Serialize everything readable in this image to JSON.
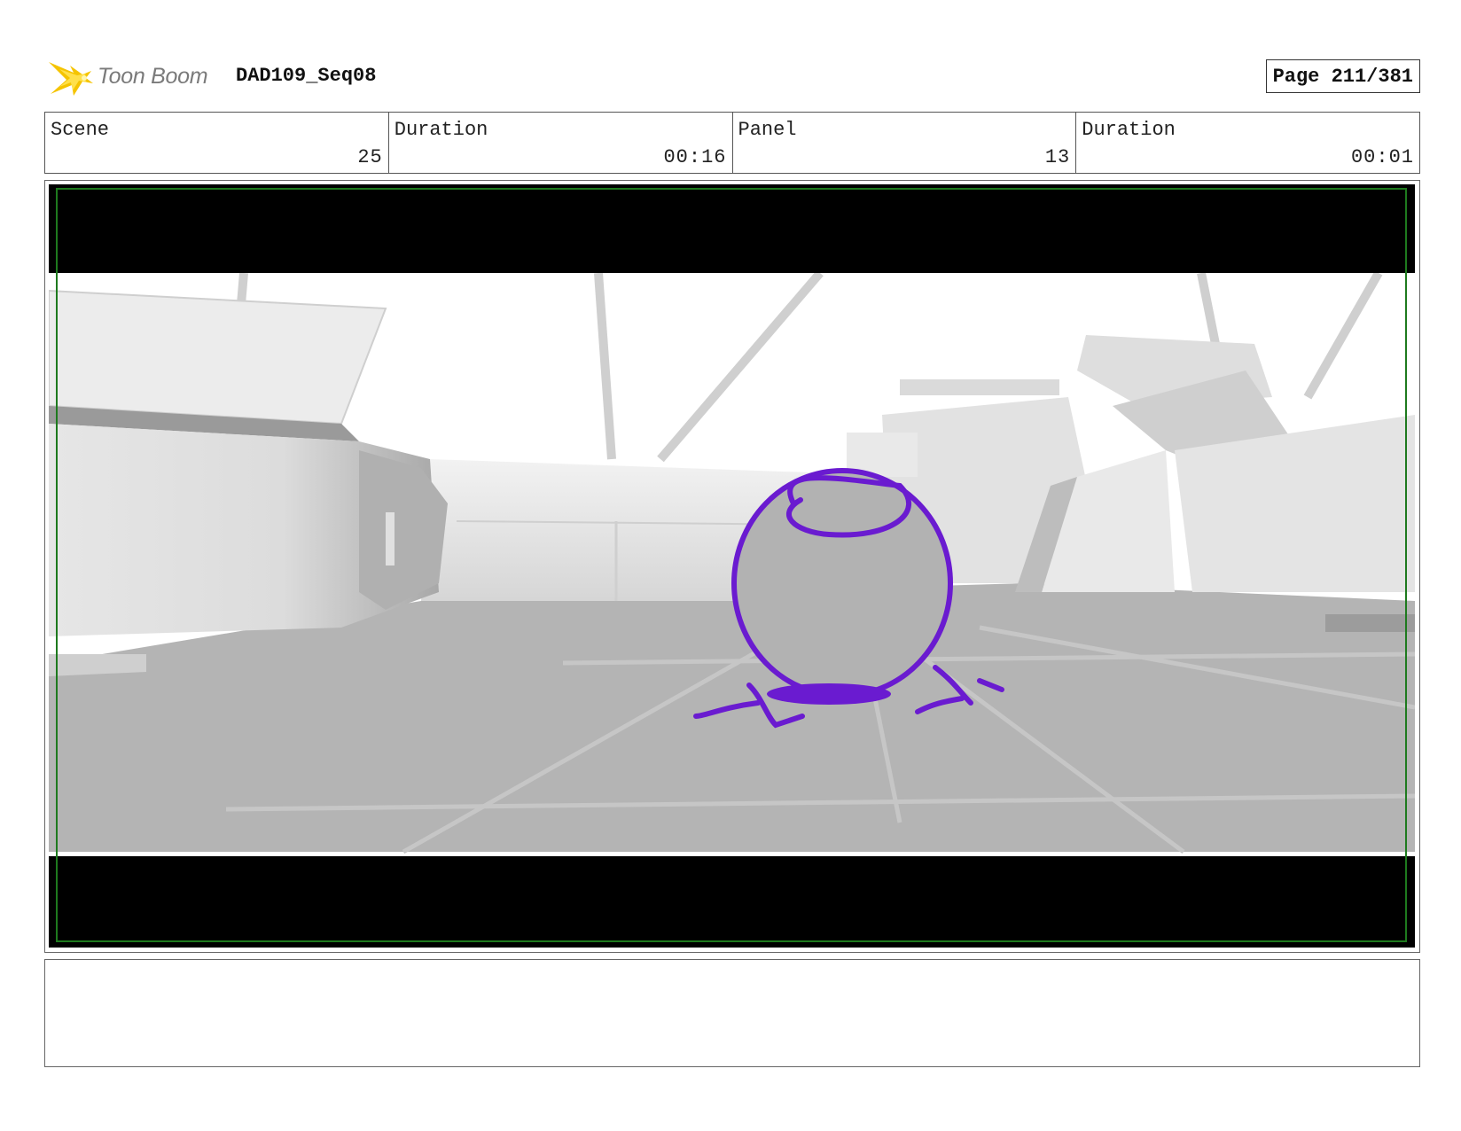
{
  "header": {
    "logo_text": "Toon Boom",
    "project_title": "DAD109_Seq08",
    "page_label": "Page 211/381"
  },
  "info": [
    {
      "label": "Scene",
      "value": "25"
    },
    {
      "label": "Duration",
      "value": "00:16"
    },
    {
      "label": "Panel",
      "value": "13"
    },
    {
      "label": "Duration",
      "value": "00:01"
    }
  ],
  "panel": {
    "description": "",
    "sketch_color": "#6a1bd0",
    "safe_frame_color": "#1e7a1e"
  },
  "notes": {
    "text": ""
  }
}
